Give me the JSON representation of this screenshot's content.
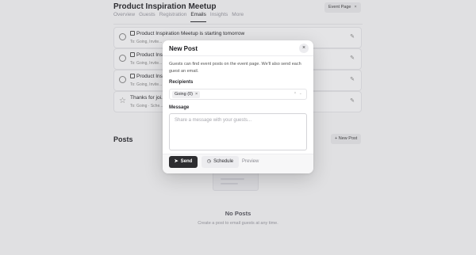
{
  "event": {
    "title": "Product Inspiration Meetup",
    "event_page_label": "Event Page",
    "event_page_close": "×"
  },
  "tabs": [
    {
      "label": "Overview"
    },
    {
      "label": "Guests"
    },
    {
      "label": "Registration"
    },
    {
      "label": "Emails",
      "active": true
    },
    {
      "label": "Insights"
    },
    {
      "label": "More"
    }
  ],
  "emails": [
    {
      "title": "Product Inspiration Meetup is starting tomorrow",
      "meta": "To: Going, Invite...",
      "icon": "clock-icon"
    },
    {
      "title": "Product Inspiration...",
      "meta": "To: Going, Invite...",
      "icon": "clock-icon"
    },
    {
      "title": "Product Inspiration...",
      "meta": "To: Going, Invite...",
      "icon": "clock-icon"
    },
    {
      "title": "Thanks for joi...",
      "meta": "To: Going · Sche...",
      "icon": "star-icon"
    }
  ],
  "posts": {
    "title": "Posts",
    "new_post_label": "+ New Post",
    "empty_title": "No Posts",
    "empty_subtitle": "Create a post to email guests at any time."
  },
  "modal": {
    "title": "New Post",
    "close_glyph": "×",
    "description": "Guests can find event posts on the event page. We'll also send each guest an email.",
    "recipients_label": "Recipients",
    "recipient_chip": "Going (0)",
    "chip_remove": "×",
    "message_label": "Message",
    "message_placeholder": "Share a message with your guests...",
    "send_label": "Send",
    "schedule_label": "Schedule",
    "preview_label": "Preview"
  },
  "colors": {
    "primary_button": "#2d2d30",
    "page_background": "#f4f4f5"
  }
}
